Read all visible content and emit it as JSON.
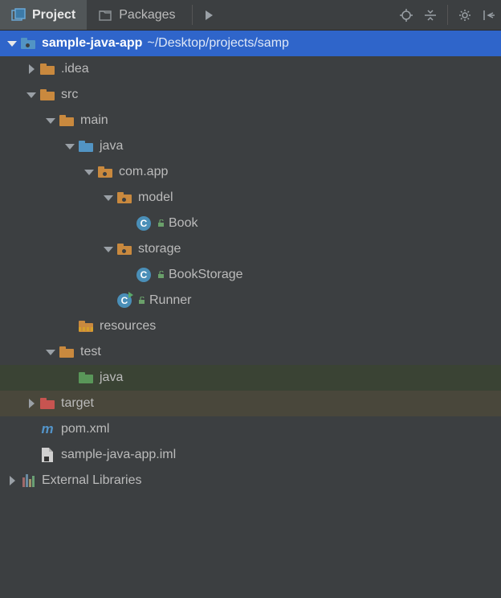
{
  "tabs": {
    "project": "Project",
    "packages": "Packages"
  },
  "tree": {
    "root": {
      "name": "sample-java-app",
      "path": "~/Desktop/projects/samp"
    },
    "idea": ".idea",
    "src": "src",
    "main": "main",
    "java": "java",
    "pkg": "com.app",
    "model": "model",
    "book": "Book",
    "storage": "storage",
    "bookStorage": "BookStorage",
    "runner": "Runner",
    "resources": "resources",
    "test": "test",
    "testJava": "java",
    "target": "target",
    "pom": "pom.xml",
    "iml": "sample-java-app.iml",
    "external": "External Libraries"
  }
}
